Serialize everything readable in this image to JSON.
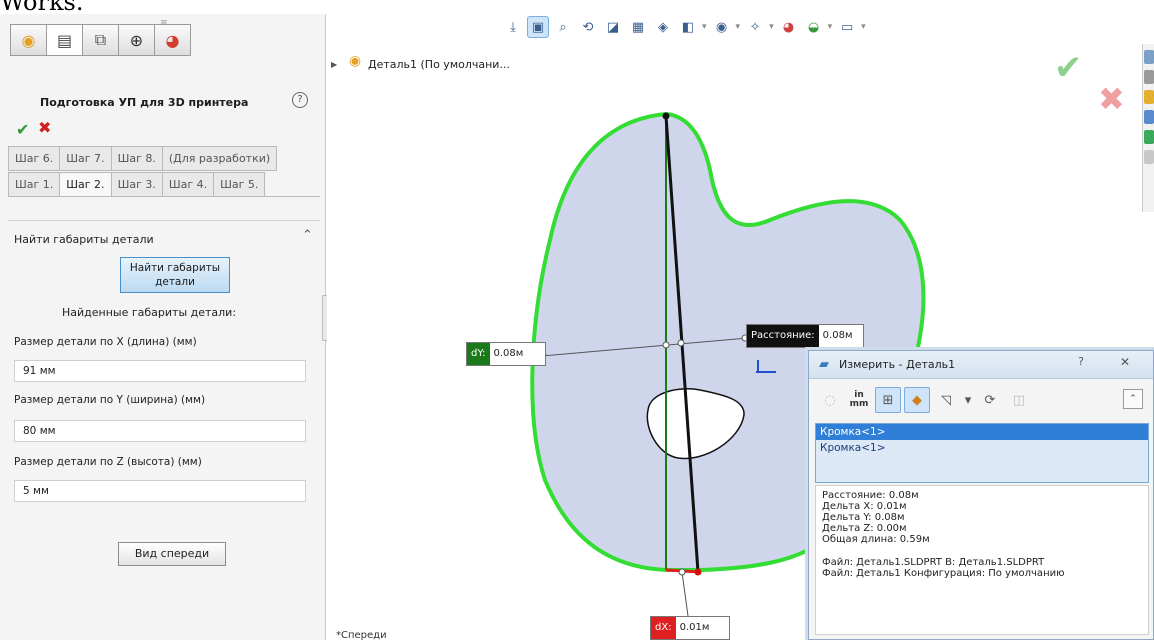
{
  "top_text": "Works.",
  "panel": {
    "tab_icons": [
      "cube-icon",
      "feature-manager-icon",
      "property-manager-icon",
      "crosshair-icon",
      "appearance-icon"
    ],
    "title": "Подготовка УП для 3D принтера",
    "help_glyph": "?",
    "ok_glyph": "✔",
    "cancel_glyph": "✖",
    "steps_row1": [
      "Шаг 6.",
      "Шаг 7.",
      "Шаг 8.",
      "(Для разработки)"
    ],
    "steps_row2": [
      "Шаг 1.",
      "Шаг 2.",
      "Шаг 3.",
      "Шаг 4.",
      "Шаг 5."
    ],
    "active_step": "Шаг 2.",
    "group_title": "Найти габариты детали",
    "find_button_line1": "Найти габариты",
    "find_button_line2": "детали",
    "found_label": "Найденные габариты детали:",
    "x_label": "Размер детали по X (длина) (мм)",
    "x_value": "91 мм",
    "y_label": "Размер детали по Y (ширина) (мм)",
    "y_value": "80 мм",
    "z_label": "Размер детали по Z (высота) (мм)",
    "z_value": "5 мм",
    "front_view_button": "Вид спереди"
  },
  "graphics": {
    "tree_item": "Деталь1  (По умолчани...",
    "view_label": "*Спереди",
    "callout_distance_label": "Расстояние:",
    "callout_distance_value": "0.08м",
    "callout_dy_label": "dY:",
    "callout_dy_value": "0.08м",
    "callout_dx_label": "dX:",
    "callout_dx_value": "0.01м",
    "colors": {
      "part_fill": "#cfd6ec",
      "outline": "#33dd33",
      "measure_line": "#111111",
      "dy_line": "#1a7a1a",
      "dx_line": "#e02020"
    }
  },
  "measure_dialog": {
    "title": "Измерить - Деталь1",
    "unit_top": "in",
    "unit_bottom": "mm",
    "selections": [
      "Кромка<1>",
      "Кромка<1>"
    ],
    "results": {
      "distance": "Расстояние: 0.08м",
      "delta_x": "Дельта X: 0.01м",
      "delta_y": "Дельта Y: 0.08м",
      "delta_z": "Дельта Z: 0.00м",
      "total_length": "Общая длина: 0.59м",
      "file_line": "Файл: Деталь1.SLDPRT В: Деталь1.SLDPRT",
      "config_line": "Файл: Деталь1 Конфигурация: По умолчанию"
    }
  }
}
